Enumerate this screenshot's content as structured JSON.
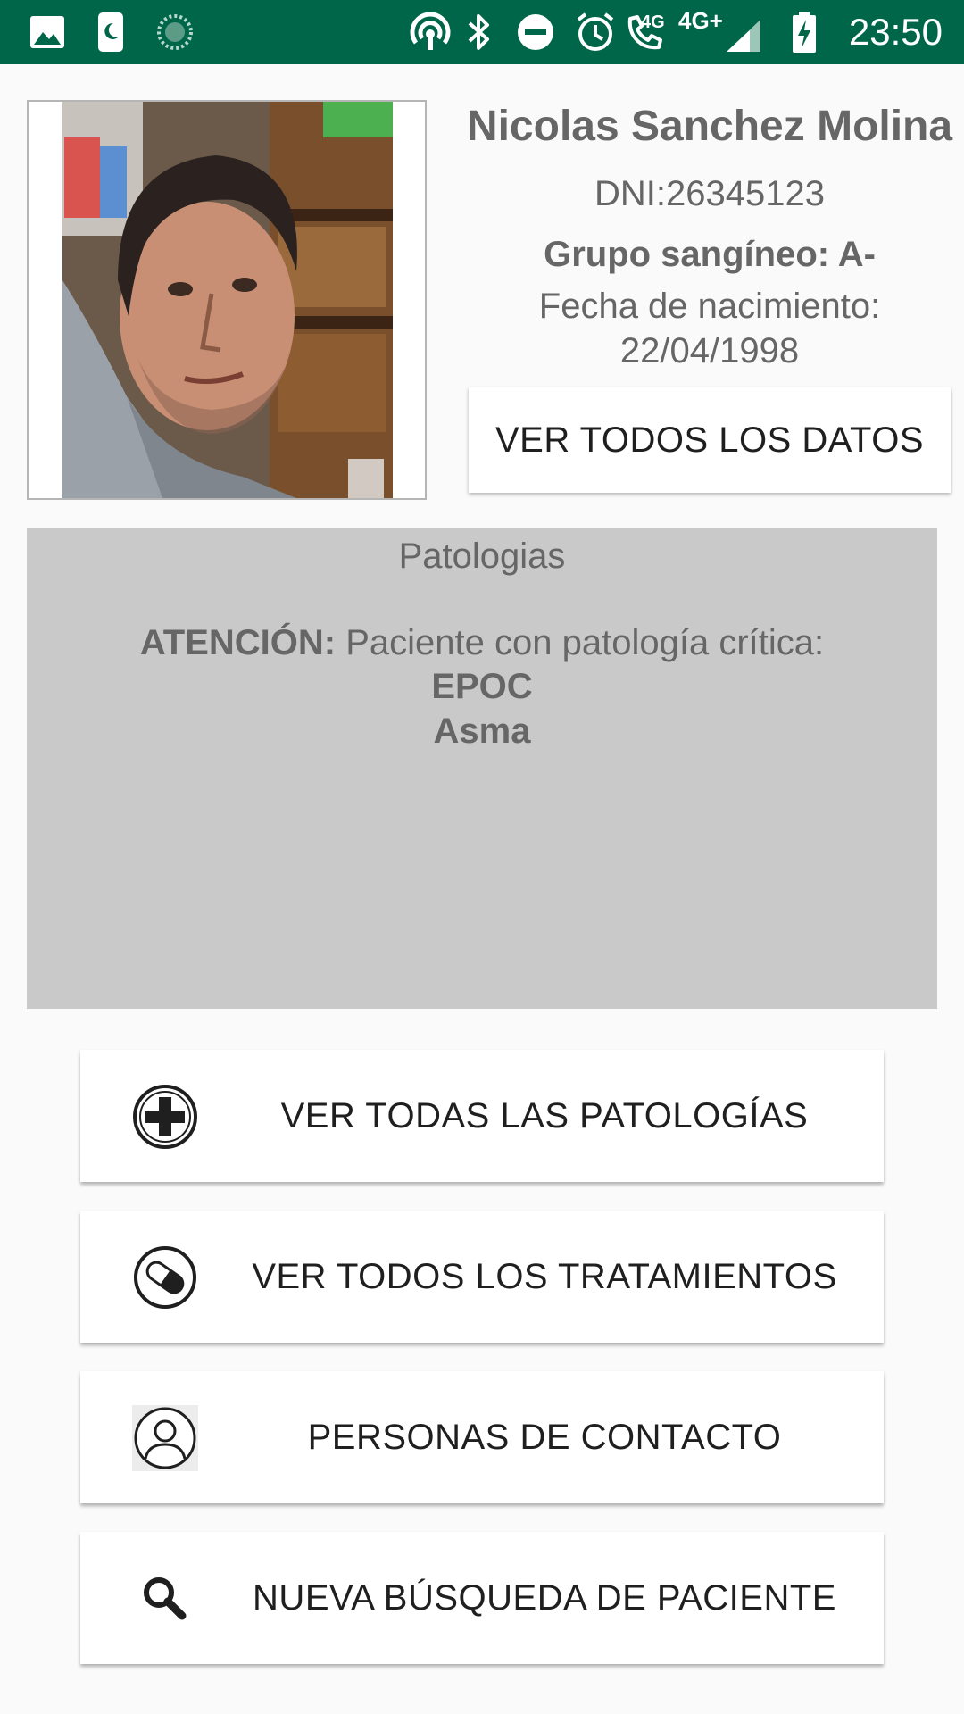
{
  "status_bar": {
    "time": "23:50",
    "network_4g_small": "4G",
    "network_4g_plus": "4G+",
    "icons": [
      "image-icon",
      "phone-moon-icon",
      "sync-icon",
      "hotspot-icon",
      "bluetooth-icon",
      "dnd-icon",
      "alarm-icon",
      "wifi-calling-icon",
      "signal-icon",
      "battery-charging-icon"
    ],
    "background": "#00664a"
  },
  "patient": {
    "name": "Nicolas Sanchez Molina",
    "dni": "DNI:26345123",
    "blood_group": "Grupo sangíneo: A-",
    "birth_label": "Fecha de nacimiento:",
    "birth_date": "22/04/1998",
    "view_all_button": "VER TODOS LOS DATOS"
  },
  "patologias": {
    "title": "Patologias",
    "warning_prefix": "ATENCIÓN:",
    "warning_text": " Paciente con patología crítica:",
    "items": [
      "EPOC",
      "Asma"
    ],
    "background": "#c9c9c9"
  },
  "actions": [
    {
      "label": "VER TODAS LAS PATOLOGÍAS",
      "icon": "medical-cross-icon"
    },
    {
      "label": "VER TODOS LOS TRATAMIENTOS",
      "icon": "pill-icon"
    },
    {
      "label": "PERSONAS DE CONTACTO",
      "icon": "person-icon"
    },
    {
      "label": "NUEVA BÚSQUEDA DE PACIENTE",
      "icon": "search-icon"
    }
  ]
}
